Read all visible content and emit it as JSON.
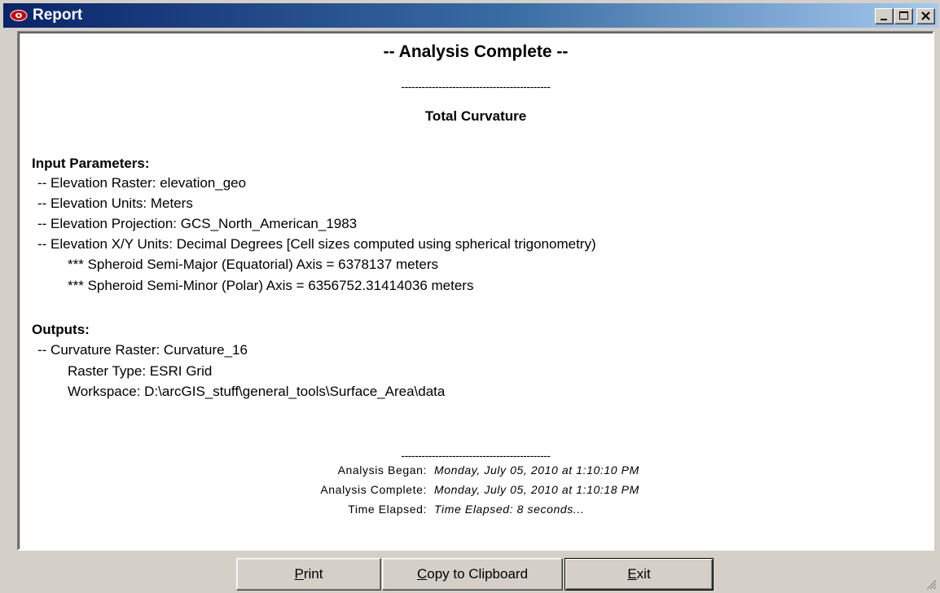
{
  "window": {
    "title": "Report"
  },
  "report": {
    "heading": "-- Analysis Complete --",
    "divider": "--------------------------------------------",
    "tool_name": "Total Curvature",
    "input_header": "Input Parameters:",
    "inputs": [
      "--  Elevation Raster:  elevation_geo",
      "--  Elevation Units:  Meters",
      "--  Elevation Projection:  GCS_North_American_1983",
      "--  Elevation X/Y Units:  Decimal Degrees [Cell sizes computed using spherical trigonometry)",
      "*** Spheroid Semi-Major (Equatorial) Axis = 6378137 meters",
      "*** Spheroid Semi-Minor (Polar) Axis = 6356752.31414036 meters"
    ],
    "output_header": "Outputs:",
    "outputs": [
      "--  Curvature Raster:  Curvature_16",
      "Raster Type:  ESRI Grid",
      "Workspace:  D:\\arcGIS_stuff\\general_tools\\Surface_Area\\data"
    ],
    "footer_divider": "--------------------------------------------",
    "began_label": "Analysis Began:",
    "began_value": "Monday, July 05, 2010 at 1:10:10 PM",
    "complete_label": "Analysis Complete:",
    "complete_value": "Monday, July 05, 2010 at 1:10:18 PM",
    "elapsed_label": "Time Elapsed:",
    "elapsed_value": "Time Elapsed: 8 seconds..."
  },
  "buttons": {
    "print_mnemonic": "P",
    "print_rest": "rint",
    "copy_mnemonic": "C",
    "copy_rest": "opy to Clipboard",
    "exit_mnemonic": "E",
    "exit_rest": "xit"
  },
  "icons": {
    "app": "eye-icon",
    "minimize": "minimize-icon",
    "maximize": "maximize-icon",
    "close": "close-icon",
    "resize": "resize-grip-icon"
  },
  "colors": {
    "titlebar_start": "#0a246a",
    "titlebar_end": "#a6caf0",
    "face": "#d4d0c8",
    "report_bg": "#ffffff",
    "app_icon": "#cc0000"
  }
}
